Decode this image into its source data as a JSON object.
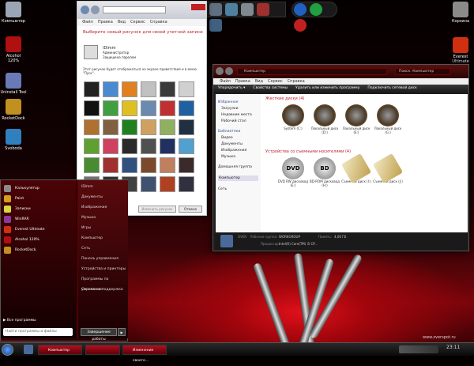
{
  "desktop": {
    "left_icons": [
      {
        "label": "Компьютер",
        "color": "#9aa6b6"
      },
      {
        "label": "Alcohol 120%",
        "color": "#b01010"
      },
      {
        "label": "Uninstall Tool",
        "color": "#6a7ab8"
      },
      {
        "label": "RocketDock",
        "color": "#c09020"
      },
      {
        "label": "Svoboda",
        "color": "#3080c0"
      }
    ],
    "right_icons": [
      {
        "label": "Корзина",
        "color": "#8a8a8a"
      },
      {
        "label": "Everest Ultimate",
        "color": "#d03010"
      }
    ],
    "watermark": "www.zverspot.ru"
  },
  "user_window": {
    "menu": [
      "Файл",
      "Правка",
      "Вид",
      "Сервис",
      "Справка"
    ],
    "heading": "Выберите новый рисунок для своей учетной записи",
    "user_name": "IDimm",
    "role": "Администратор",
    "password": "Защищена паролем",
    "desc": "Этот рисунок будет отображаться на экране приветствия и в меню \"Пуск\".",
    "ok_button": "Изменить рисунок",
    "cancel_button": "Отмена"
  },
  "explorer": {
    "address": "Компьютер",
    "search": "Поиск: Компьютер",
    "menu": [
      "Файл",
      "Правка",
      "Вид",
      "Сервис",
      "Справка"
    ],
    "toolbar": [
      "Упорядочить ▾",
      "Свойства системы",
      "Удалить или изменить программу",
      "Подключить сетевой диск"
    ],
    "sidebar": {
      "favorites_title": "Избранное",
      "favorites": [
        "Загрузки",
        "Недавние места",
        "Рабочий стол"
      ],
      "libraries_title": "Библиотеки",
      "libraries": [
        "Видео",
        "Документы",
        "Изображения",
        "Музыка"
      ],
      "homegroup": "Домашняя группа",
      "computer": "Компьютер",
      "network": "Сеть"
    },
    "hdd_section": "Жесткие диски (4)",
    "hdds": [
      "System (C:)",
      "Локальный диск (D:)",
      "Локальный диск (E:)",
      "Локальный диск (G:)"
    ],
    "removable_section": "Устройства со съемными носителями (4)",
    "removables": [
      {
        "label": "DVD RW дисковод (E:)",
        "tag": "DVD"
      },
      {
        "label": "BD-ROM дисковод (H:)",
        "tag": "BD"
      },
      {
        "label": "Съемный диск (I:)",
        "tag": ""
      },
      {
        "label": "Съемный диск (J:)",
        "tag": ""
      }
    ],
    "status": {
      "name": "OVER",
      "workgroup_label": "Рабочая группа:",
      "workgroup": "WORKGROUP",
      "memory_label": "Память:",
      "memory": "4,00 ГБ",
      "cpu_label": "Процессор:",
      "cpu": "Intel(R) Core(TM) i5 CP..."
    }
  },
  "start_menu": {
    "left": [
      {
        "label": "Калькулятор",
        "color": "#8a8a8a"
      },
      {
        "label": "Paint",
        "color": "#d0a020"
      },
      {
        "label": "Записки",
        "color": "#d8d840"
      },
      {
        "label": "WinRAR",
        "color": "#8a3a9a"
      },
      {
        "label": "Everest Ultimate",
        "color": "#d03010"
      },
      {
        "label": "Alcohol 120%",
        "color": "#b01010"
      },
      {
        "label": "RocketDock",
        "color": "#c09020"
      }
    ],
    "right": [
      "IDimm",
      "Документы",
      "Изображения",
      "Музыка",
      "Игры",
      "Компьютер",
      "Сеть",
      "Панель управления",
      "Устройства и принтеры",
      "Программы по умолчанию",
      "Справка и поддержка"
    ],
    "all_programs": "Все программы",
    "search_placeholder": "Найти программы и файлы",
    "shutdown": "Завершение работы"
  },
  "taskbar": {
    "items": [
      "Компьютер",
      "",
      "Изменение своего..."
    ],
    "clock": "23:11"
  }
}
